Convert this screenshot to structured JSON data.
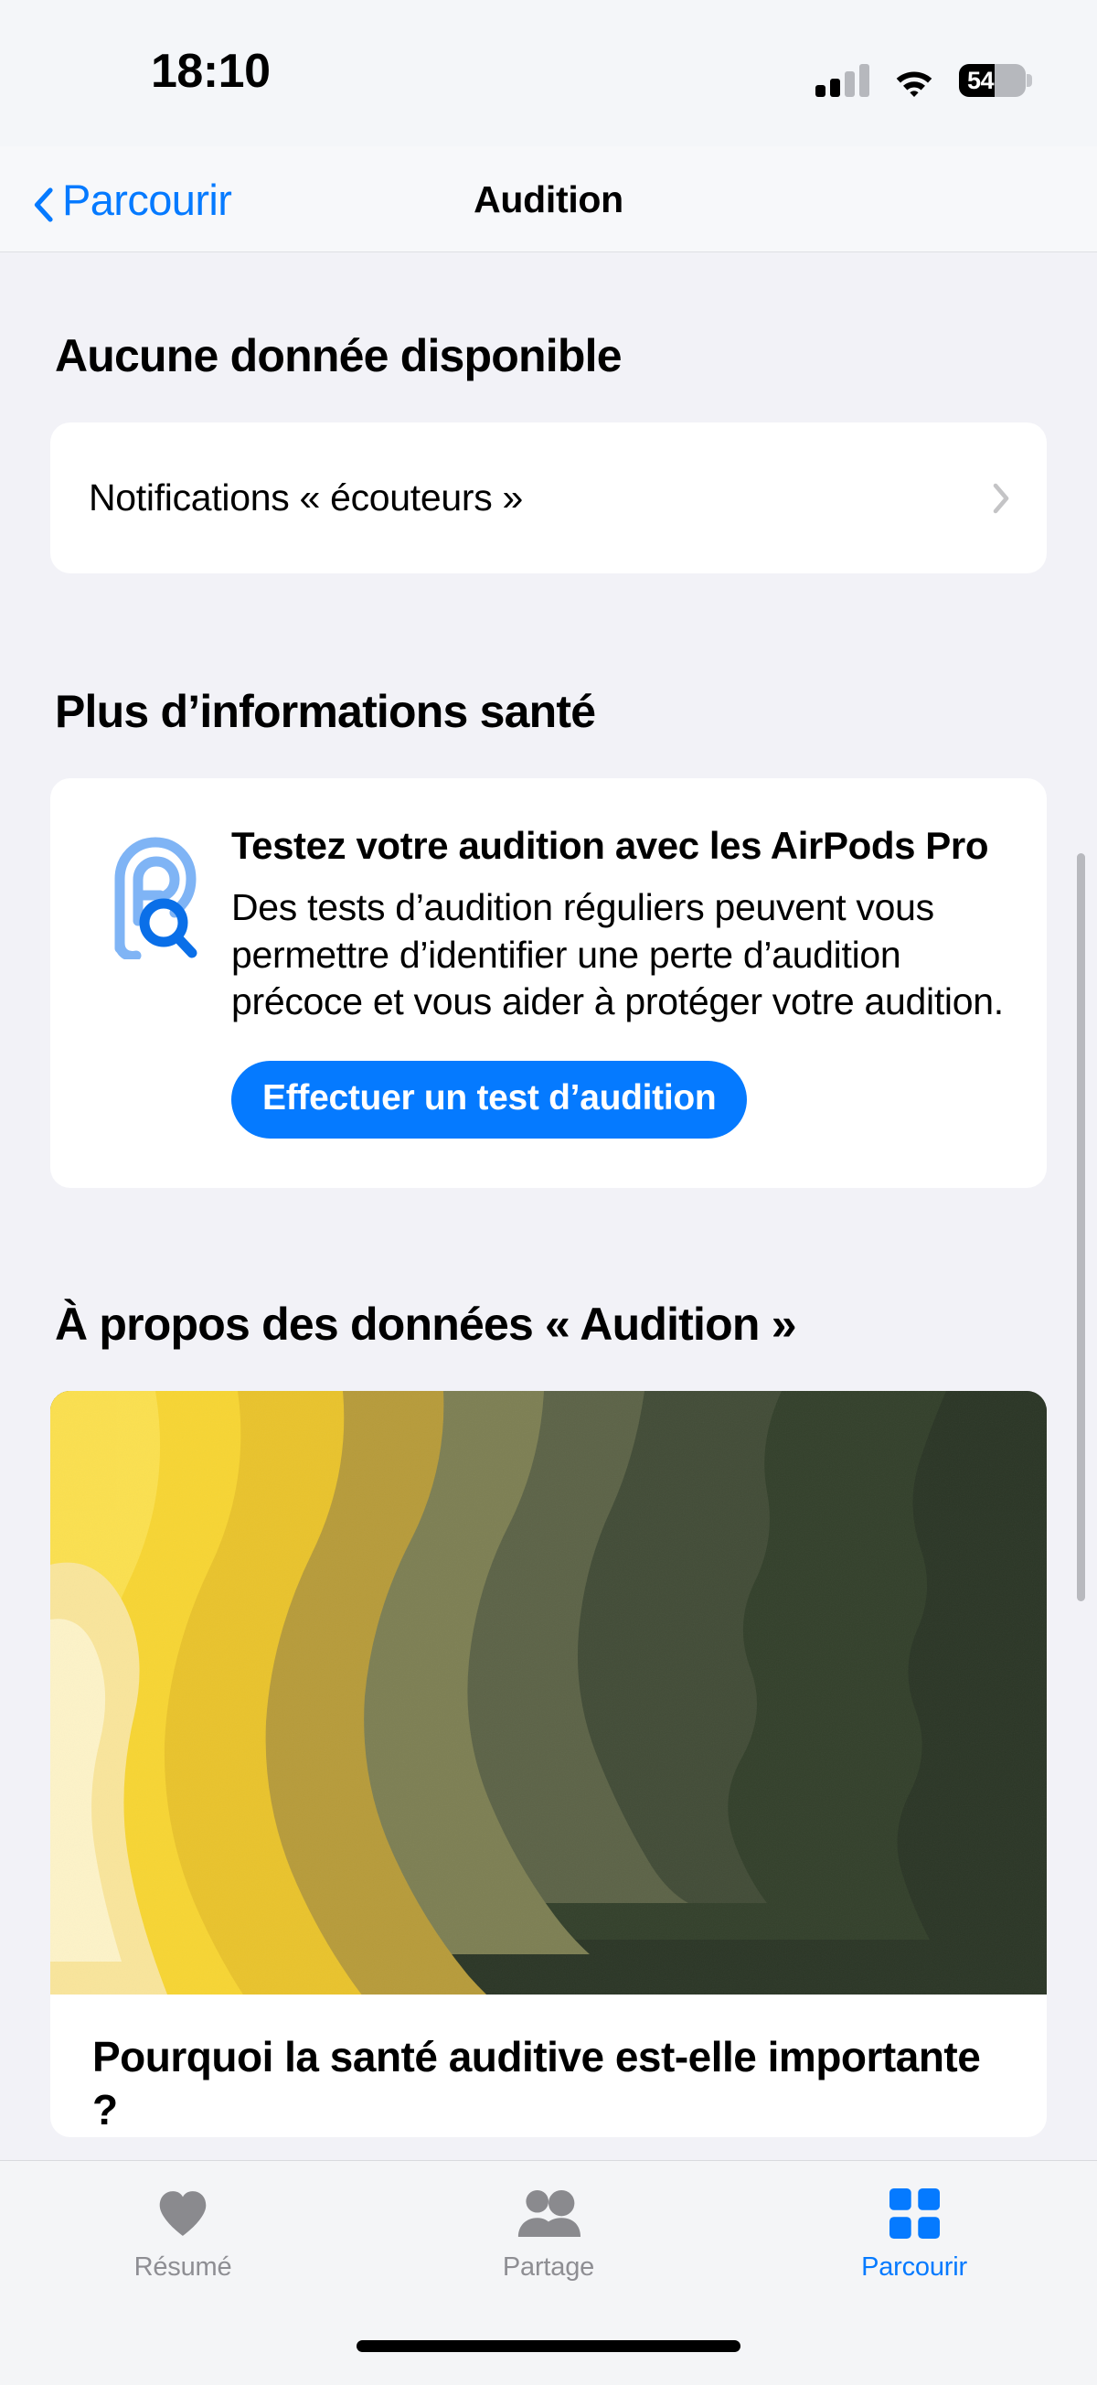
{
  "status_bar": {
    "time": "18:10",
    "signal_icon": "cellular-signal-icon",
    "signal_bars_filled": 2,
    "signal_bars_total": 4,
    "wifi_icon": "wifi-icon",
    "battery_icon": "battery-icon",
    "battery_percent": "54",
    "battery_level": 54
  },
  "nav": {
    "back_icon": "chevron-left-icon",
    "back_label": "Parcourir",
    "title": "Audition"
  },
  "no_data_section": {
    "heading": "Aucune donnée disponible",
    "rows": [
      {
        "label": "Notifications « écouteurs »",
        "disclosure_icon": "chevron-right-icon"
      }
    ]
  },
  "more_info_section": {
    "heading": "Plus d’informations santé",
    "card": {
      "icon": "ear-with-magnifier-icon",
      "title": "Testez votre audition avec les AirPods Pro",
      "body": "Des tests d’audition réguliers peuvent vous permettre d’identifier une perte d’audition précoce et vous aider à protéger votre audition.",
      "button_label": "Effectuer un test d’audition"
    }
  },
  "about_section": {
    "heading": "À propos des données « Audition »",
    "article": {
      "image_alt": "torn-paper-layers-artwork",
      "title": "Pourquoi la santé auditive est-elle importante ?"
    }
  },
  "tab_bar": {
    "tabs": [
      {
        "label": "Résumé",
        "icon": "heart-icon",
        "active": false
      },
      {
        "label": "Partage",
        "icon": "people-icon",
        "active": false
      },
      {
        "label": "Parcourir",
        "icon": "grid-squares-icon",
        "active": true
      }
    ]
  },
  "colors": {
    "accent": "#057aff",
    "background": "#f2f2f7",
    "card": "#ffffff",
    "inactive_tab": "#8e8e93",
    "chevron_gray": "#c4c4c6"
  },
  "artwork_palette": [
    "#fdf3c8",
    "#f9e59b",
    "#fbe04f",
    "#f7d533",
    "#e9c32c",
    "#b79b3a",
    "#7d7f53",
    "#5c6347",
    "#424c37",
    "#33402b",
    "#2b3626"
  ]
}
